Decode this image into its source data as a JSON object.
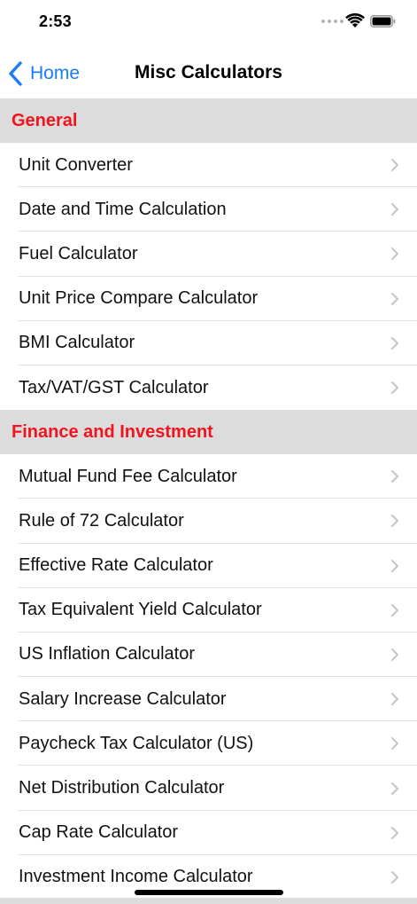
{
  "status_bar": {
    "time": "2:53"
  },
  "nav": {
    "back_label": "Home",
    "title": "Misc Calculators"
  },
  "colors": {
    "accent": "#1a7cf5",
    "section_text": "#f0141e",
    "section_bg": "#dcdcdc"
  },
  "sections": [
    {
      "title": "General",
      "items": [
        "Unit Converter",
        "Date and Time Calculation",
        "Fuel Calculator",
        "Unit Price Compare Calculator",
        "BMI Calculator",
        "Tax/VAT/GST Calculator"
      ]
    },
    {
      "title": "Finance and Investment",
      "items": [
        "Mutual Fund Fee Calculator",
        "Rule of 72 Calculator",
        "Effective Rate Calculator",
        "Tax Equivalent Yield Calculator",
        "US Inflation Calculator",
        "Salary Increase Calculator",
        "Paycheck Tax Calculator (US)",
        "Net Distribution Calculator",
        "Cap Rate Calculator",
        "Investment Income Calculator"
      ]
    }
  ]
}
